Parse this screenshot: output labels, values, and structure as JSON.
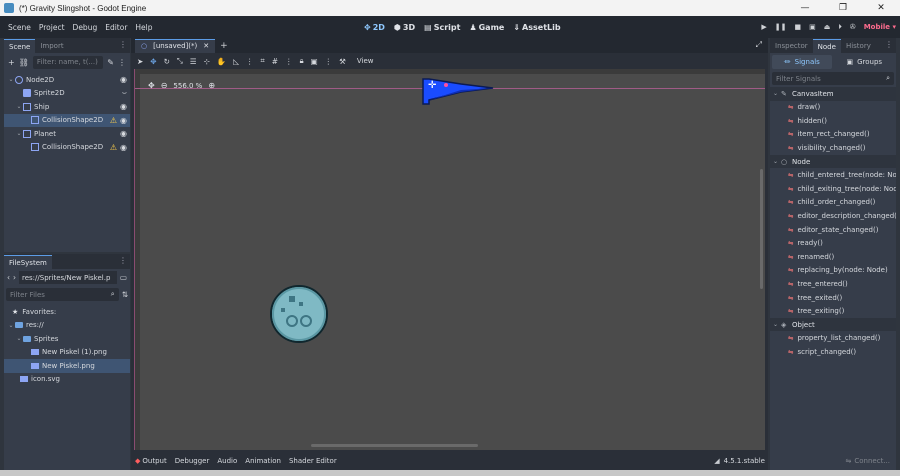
{
  "window": {
    "title": "(*) Gravity Slingshot - Godot Engine",
    "minimize": "—",
    "maximize": "❐",
    "close": "✕"
  },
  "menu": {
    "items": [
      "Scene",
      "Project",
      "Debug",
      "Editor",
      "Help"
    ]
  },
  "workspaces": {
    "items": [
      {
        "label": "2D",
        "active": true
      },
      {
        "label": "3D",
        "active": false
      },
      {
        "label": "Script",
        "active": false
      },
      {
        "label": "Game",
        "active": false
      },
      {
        "label": "AssetLib",
        "active": false
      }
    ]
  },
  "run": {
    "renderer": "Mobile"
  },
  "scene_dock": {
    "tabs": [
      "Scene",
      "Import"
    ],
    "filter_placeholder": "Filter: name, t(...)",
    "nodes": [
      {
        "label": "Node2D",
        "depth": 0,
        "expanded": true,
        "icon": "node2d-icon",
        "warn": false,
        "eye": true,
        "selected": false
      },
      {
        "label": "Sprite2D",
        "depth": 1,
        "expanded": false,
        "icon": "sprite2d-icon",
        "warn": false,
        "eye": false,
        "selected": false
      },
      {
        "label": "Ship",
        "depth": 1,
        "expanded": true,
        "icon": "area2d-icon",
        "warn": false,
        "eye": true,
        "selected": false
      },
      {
        "label": "CollisionShape2D",
        "depth": 2,
        "expanded": false,
        "icon": "collision-icon",
        "warn": true,
        "eye": true,
        "selected": true
      },
      {
        "label": "Planet",
        "depth": 1,
        "expanded": true,
        "icon": "area2d-icon",
        "warn": false,
        "eye": true,
        "selected": false
      },
      {
        "label": "CollisionShape2D",
        "depth": 2,
        "expanded": false,
        "icon": "collision-icon",
        "warn": true,
        "eye": true,
        "selected": false
      }
    ]
  },
  "filesystem": {
    "tab": "FileSystem",
    "path": "res://Sprites/New Piskel.p",
    "filter_placeholder": "Filter Files",
    "items": [
      {
        "label": "Favorites:",
        "depth": 0,
        "icon": "star-icon",
        "selected": false
      },
      {
        "label": "res://",
        "depth": 0,
        "icon": "folder-icon",
        "selected": false
      },
      {
        "label": "Sprites",
        "depth": 1,
        "icon": "folder-icon",
        "selected": false
      },
      {
        "label": "New Piskel (1).png",
        "depth": 2,
        "icon": "image-icon",
        "selected": false
      },
      {
        "label": "New Piskel.png",
        "depth": 2,
        "icon": "image-icon",
        "selected": true
      },
      {
        "label": "icon.svg",
        "depth": 1,
        "icon": "image-icon",
        "selected": false
      }
    ]
  },
  "editor": {
    "doc_tab": "[unsaved](*)",
    "view_menu": "View",
    "zoom": "556.0 %"
  },
  "bottom_panel": {
    "tabs": [
      "Output",
      "Debugger",
      "Audio",
      "Animation",
      "Shader Editor"
    ],
    "version": "4.5.1.stable"
  },
  "inspector_dock": {
    "tabs": [
      "Inspector",
      "Node",
      "History"
    ],
    "active_tab": "Node",
    "sub_tabs": [
      "Signals",
      "Groups"
    ],
    "filter_placeholder": "Filter Signals",
    "sections": [
      {
        "title": "CanvasItem",
        "icon": "canvasitem-icon",
        "signals": [
          "draw()",
          "hidden()",
          "item_rect_changed()",
          "visibility_changed()"
        ]
      },
      {
        "title": "Node",
        "icon": "node-icon",
        "signals": [
          "child_entered_tree(node: No...",
          "child_exiting_tree(node: Node)",
          "child_order_changed()",
          "editor_description_changed(...",
          "editor_state_changed()",
          "ready()",
          "renamed()",
          "replacing_by(node: Node)",
          "tree_entered()",
          "tree_exited()",
          "tree_exiting()"
        ]
      },
      {
        "title": "Object",
        "icon": "object-icon",
        "signals": [
          "property_list_changed()",
          "script_changed()"
        ]
      }
    ],
    "connect_label": "Connect..."
  },
  "colors": {
    "accent": "#5c9ce6",
    "selection": "#3f5573",
    "warning": "#ffd04c",
    "signal": "#ff7a7a",
    "ship": "#1a4cff",
    "planet": "#7fb9c4"
  }
}
